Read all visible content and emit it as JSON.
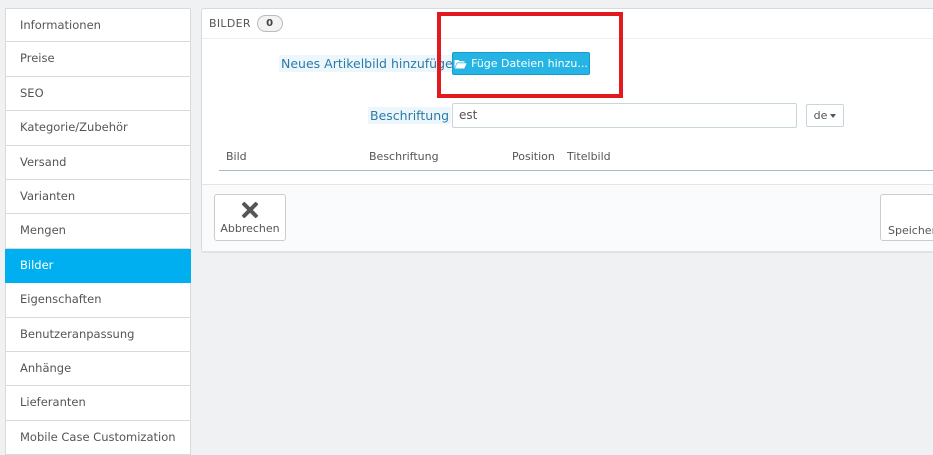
{
  "sidebar": {
    "items": [
      {
        "label": "Informationen"
      },
      {
        "label": "Preise"
      },
      {
        "label": "SEO"
      },
      {
        "label": "Kategorie/Zubehör"
      },
      {
        "label": "Versand"
      },
      {
        "label": "Varianten"
      },
      {
        "label": "Mengen"
      },
      {
        "label": "Bilder"
      },
      {
        "label": "Eigenschaften"
      },
      {
        "label": "Benutzeranpassung"
      },
      {
        "label": "Anhänge"
      },
      {
        "label": "Lieferanten"
      },
      {
        "label": "Mobile Case Customization"
      }
    ],
    "active_index": 7
  },
  "panel": {
    "title": "BILDER",
    "count": "0",
    "add_image_label": "Neues Artikelbild hinzufügen",
    "upload_button": "Füge Dateien hinzu...",
    "caption_label": "Beschriftung",
    "caption_value": "est",
    "language": "de",
    "table_headers": {
      "image": "Bild",
      "caption": "Beschriftung",
      "position": "Position",
      "cover": "Titelbild"
    },
    "cancel_label": "Abbrechen",
    "save_label": "Speicher"
  },
  "colors": {
    "accent": "#00aff0",
    "upload_button": "#25b4e4",
    "highlight_box": "#e2191f"
  }
}
